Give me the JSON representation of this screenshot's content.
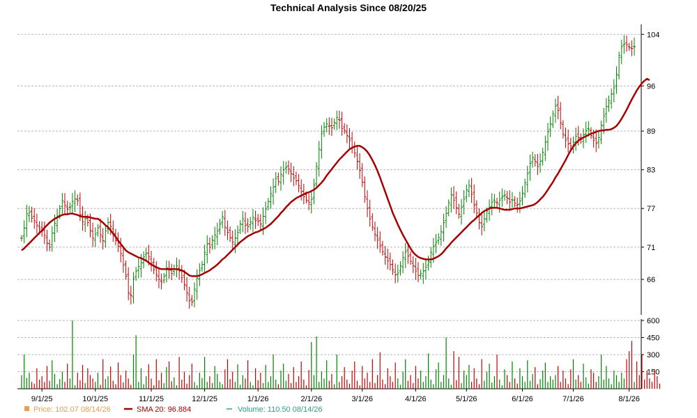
{
  "chart_data": {
    "type": "ohlc_with_sma_and_volume",
    "title": "Technical Analysis Since 08/20/25",
    "price_axis": {
      "ticks": [
        66,
        71,
        77,
        83,
        89,
        96,
        104
      ],
      "range": [
        60.5,
        105
      ]
    },
    "volume_axis": {
      "ticks": [
        150,
        300,
        450,
        600
      ],
      "range": [
        0,
        600
      ]
    },
    "x_ticks": [
      {
        "label": "9/1/25",
        "index": 8
      },
      {
        "label": "10/1/25",
        "index": 29
      },
      {
        "label": "11/1/25",
        "index": 51
      },
      {
        "label": "12/1/25",
        "index": 72
      },
      {
        "label": "1/1/26",
        "index": 93
      },
      {
        "label": "2/1/26",
        "index": 114
      },
      {
        "label": "3/1/26",
        "index": 134
      },
      {
        "label": "4/1/26",
        "index": 155
      },
      {
        "label": "5/1/26",
        "index": 175
      },
      {
        "label": "6/1/26",
        "index": 197
      },
      {
        "label": "7/1/26",
        "index": 217
      },
      {
        "label": "8/1/26",
        "index": 239
      }
    ],
    "closes": [
      72.4,
      74.0,
      76.2,
      76.4,
      75.5,
      75.1,
      74.4,
      73.8,
      73.5,
      72.8,
      71.6,
      71.0,
      73.2,
      74.7,
      75.8,
      77.0,
      78.2,
      77.5,
      76.9,
      77.2,
      78.1,
      78.5,
      78.2,
      76.0,
      74.9,
      75.4,
      74.8,
      73.6,
      72.4,
      73.0,
      74.0,
      72.9,
      72.0,
      73.5,
      74.8,
      74.2,
      73.1,
      72.0,
      71.2,
      70.0,
      68.2,
      66.5,
      63.9,
      63.5,
      66.1,
      67.3,
      68.0,
      68.6,
      69.5,
      70.1,
      69.5,
      68.5,
      67.5,
      66.7,
      66.0,
      65.6,
      66.5,
      67.8,
      67.5,
      66.9,
      67.6,
      68.1,
      67.3,
      66.3,
      65.2,
      63.9,
      62.7,
      62.5,
      64.5,
      66.2,
      67.4,
      68.3,
      70.2,
      71.5,
      71.0,
      72.1,
      72.9,
      73.5,
      74.6,
      75.7,
      74.1,
      73.3,
      72.4,
      71.8,
      72.4,
      73.3,
      74.6,
      75.4,
      74.4,
      74.2,
      74.9,
      75.6,
      75.1,
      75.0,
      74.6,
      75.8,
      76.9,
      78.1,
      79.3,
      80.3,
      81.6,
      81.2,
      82.3,
      83.0,
      83.4,
      83.1,
      82.4,
      81.7,
      81.3,
      80.5,
      79.6,
      78.8,
      78.3,
      77.9,
      78.4,
      80.6,
      83.5,
      86.2,
      88.6,
      89.6,
      90.1,
      89.8,
      89.5,
      90.3,
      91.1,
      90.7,
      89.4,
      89.1,
      88.3,
      87.6,
      86.5,
      85.6,
      84.3,
      82.9,
      81.1,
      78.8,
      77.0,
      75.4,
      74.1,
      73.0,
      72.1,
      71.2,
      70.3,
      69.5,
      68.9,
      68.3,
      67.5,
      66.7,
      67.0,
      68.1,
      69.4,
      70.3,
      69.6,
      68.8,
      68.1,
      67.3,
      66.6,
      66.9,
      67.3,
      67.9,
      68.8,
      70.2,
      71.1,
      71.8,
      72.5,
      73.4,
      74.8,
      76.2,
      77.9,
      79.1,
      78.3,
      77.1,
      76.1,
      77.2,
      78.5,
      79.9,
      80.6,
      79.2,
      77.5,
      76.3,
      74.8,
      74.2,
      75.4,
      76.6,
      77.2,
      78.0,
      78.1,
      77.9,
      78.3,
      78.8,
      79.1,
      78.6,
      78.0,
      78.3,
      77.8,
      77.6,
      78.2,
      79.4,
      81.0,
      82.4,
      84.0,
      84.9,
      84.3,
      83.5,
      84.3,
      85.7,
      87.3,
      88.9,
      90.1,
      91.7,
      92.9,
      92.2,
      90.3,
      88.5,
      87.6,
      87.0,
      86.7,
      87.3,
      88.2,
      88.0,
      87.7,
      88.4,
      89.1,
      89.3,
      88.3,
      87.6,
      87.1,
      88.0,
      89.9,
      91.3,
      92.8,
      93.7,
      94.7,
      95.7,
      97.8,
      100.7,
      102.1,
      102.5,
      102.4,
      102.0,
      101.8,
      102.07
    ],
    "sma": [
      70.5,
      70.8,
      71.2,
      71.6,
      72.0,
      72.4,
      72.8,
      73.2,
      73.6,
      74.0,
      74.4,
      74.8,
      75.1,
      75.4,
      75.6,
      75.8,
      76.0,
      76.1,
      76.1,
      76.2,
      76.2,
      76.1,
      76.0,
      75.8,
      75.7,
      75.7,
      75.7,
      75.6,
      75.5,
      75.4,
      75.4,
      75.1,
      74.8,
      74.4,
      74.1,
      73.6,
      73.1,
      72.6,
      72.0,
      71.5,
      71.0,
      70.5,
      70.2,
      70.0,
      69.8,
      69.6,
      69.4,
      69.3,
      69.1,
      68.9,
      68.6,
      68.3,
      68.1,
      67.9,
      67.7,
      67.6,
      67.6,
      67.6,
      67.6,
      67.6,
      67.6,
      67.6,
      67.5,
      67.4,
      67.2,
      66.9,
      66.6,
      66.5,
      66.5,
      66.5,
      66.6,
      66.8,
      67.0,
      67.2,
      67.4,
      67.7,
      68.0,
      68.3,
      68.7,
      69.1,
      69.4,
      69.8,
      70.2,
      70.6,
      71.0,
      71.4,
      71.8,
      72.1,
      72.4,
      72.7,
      72.9,
      73.1,
      73.3,
      73.4,
      73.6,
      73.8,
      74.0,
      74.3,
      74.6,
      75.0,
      75.4,
      75.8,
      76.3,
      76.7,
      77.2,
      77.6,
      78.0,
      78.3,
      78.6,
      78.8,
      79.0,
      79.2,
      79.4,
      79.5,
      79.7,
      79.9,
      80.2,
      80.6,
      81.0,
      81.5,
      82.1,
      82.6,
      83.1,
      83.6,
      84.1,
      84.6,
      85.0,
      85.4,
      85.8,
      86.2,
      86.4,
      86.6,
      86.7,
      86.7,
      86.5,
      86.2,
      85.8,
      85.2,
      84.5,
      83.7,
      82.8,
      81.8,
      80.7,
      79.6,
      78.5,
      77.4,
      76.3,
      75.4,
      74.5,
      73.7,
      72.9,
      72.2,
      71.5,
      70.8,
      70.2,
      69.8,
      69.5,
      69.3,
      69.2,
      69.1,
      69.1,
      69.1,
      69.2,
      69.4,
      69.6,
      69.9,
      70.3,
      70.8,
      71.2,
      71.7,
      72.1,
      72.5,
      72.9,
      73.3,
      73.7,
      74.1,
      74.5,
      74.9,
      75.2,
      75.6,
      75.9,
      76.3,
      76.6,
      76.8,
      77.0,
      77.1,
      77.1,
      77.1,
      77.0,
      76.9,
      76.8,
      76.8,
      76.8,
      76.9,
      77.0,
      77.0,
      77.0,
      77.1,
      77.2,
      77.3,
      77.4,
      77.5,
      77.7,
      78.0,
      78.4,
      78.8,
      79.3,
      79.9,
      80.5,
      81.1,
      81.8,
      82.4,
      83.1,
      83.8,
      84.5,
      85.3,
      86.0,
      86.6,
      87.1,
      87.5,
      87.8,
      88.0,
      88.2,
      88.4,
      88.6,
      88.7,
      88.9,
      89.0,
      89.1,
      89.1,
      89.2,
      89.2,
      89.3,
      89.5,
      89.8,
      90.3,
      90.9,
      91.6,
      92.3,
      93.1,
      93.9,
      94.6,
      95.3,
      95.9,
      96.4,
      96.8,
      97.1,
      96.884
    ],
    "volumes": [
      120,
      300,
      95,
      140,
      60,
      45,
      180,
      80,
      110,
      60,
      200,
      70,
      250,
      130,
      40,
      85,
      150,
      60,
      220,
      90,
      600,
      30,
      140,
      75,
      210,
      50,
      180,
      120,
      90,
      60,
      140,
      35,
      260,
      85,
      110,
      195,
      70,
      40,
      230,
      120,
      55,
      160,
      90,
      35,
      300,
      470,
      60,
      180,
      40,
      110,
      215,
      90,
      30,
      260,
      75,
      140,
      50,
      190,
      240,
      65,
      100,
      30,
      280,
      80,
      150,
      45,
      120,
      220,
      60,
      30,
      140,
      95,
      280,
      60,
      110,
      50,
      200,
      130,
      60,
      40,
      170,
      260,
      85,
      150,
      60,
      215,
      35,
      120,
      90,
      250,
      60,
      30,
      180,
      75,
      140,
      50,
      210,
      60,
      110,
      300,
      80,
      40,
      160,
      220,
      70,
      130,
      50,
      190,
      60,
      110,
      240,
      80,
      30,
      165,
      410,
      120,
      460,
      60,
      150,
      90,
      250,
      70,
      130,
      40,
      300,
      60,
      110,
      190,
      80,
      45,
      160,
      240,
      70,
      30,
      200,
      90,
      140,
      60,
      260,
      50,
      120,
      320,
      80,
      40,
      180,
      110,
      60,
      230,
      90,
      35,
      150,
      260,
      70,
      120,
      50,
      200,
      90,
      160,
      60,
      110,
      310,
      80,
      40,
      170,
      230,
      60,
      120,
      450,
      90,
      35,
      330,
      75,
      280,
      50,
      160,
      120,
      210,
      60,
      180,
      90,
      40,
      260,
      70,
      150,
      220,
      55,
      110,
      300,
      80,
      30,
      170,
      120,
      60,
      240,
      90,
      45,
      180,
      110,
      60,
      250,
      70,
      130,
      190,
      40,
      85,
      160,
      230,
      60,
      110,
      80,
      120,
      200,
      60,
      160,
      90,
      40,
      170,
      260,
      80,
      120,
      60,
      220,
      100,
      45,
      170,
      140,
      60,
      110,
      300,
      80,
      200,
      90,
      40,
      160,
      120,
      60,
      140,
      90,
      260,
      330,
      420,
      60,
      240,
      120,
      300,
      80,
      160,
      90,
      60,
      170,
      110,
      45
    ]
  },
  "legend": [
    {
      "label": "Price: 102.07  08/14/26",
      "color": "#e8a04c",
      "marker": "square"
    },
    {
      "label": "SMA 20: 96.884",
      "color": "#a50000",
      "marker": "line"
    },
    {
      "label": "Volume: 110.50  08/14/26",
      "color": "#2aa08a",
      "marker": "dash"
    }
  ],
  "colors": {
    "up": "#008000",
    "down": "#c00000",
    "sma": "#a50000",
    "grid": "#b8b8b8"
  }
}
